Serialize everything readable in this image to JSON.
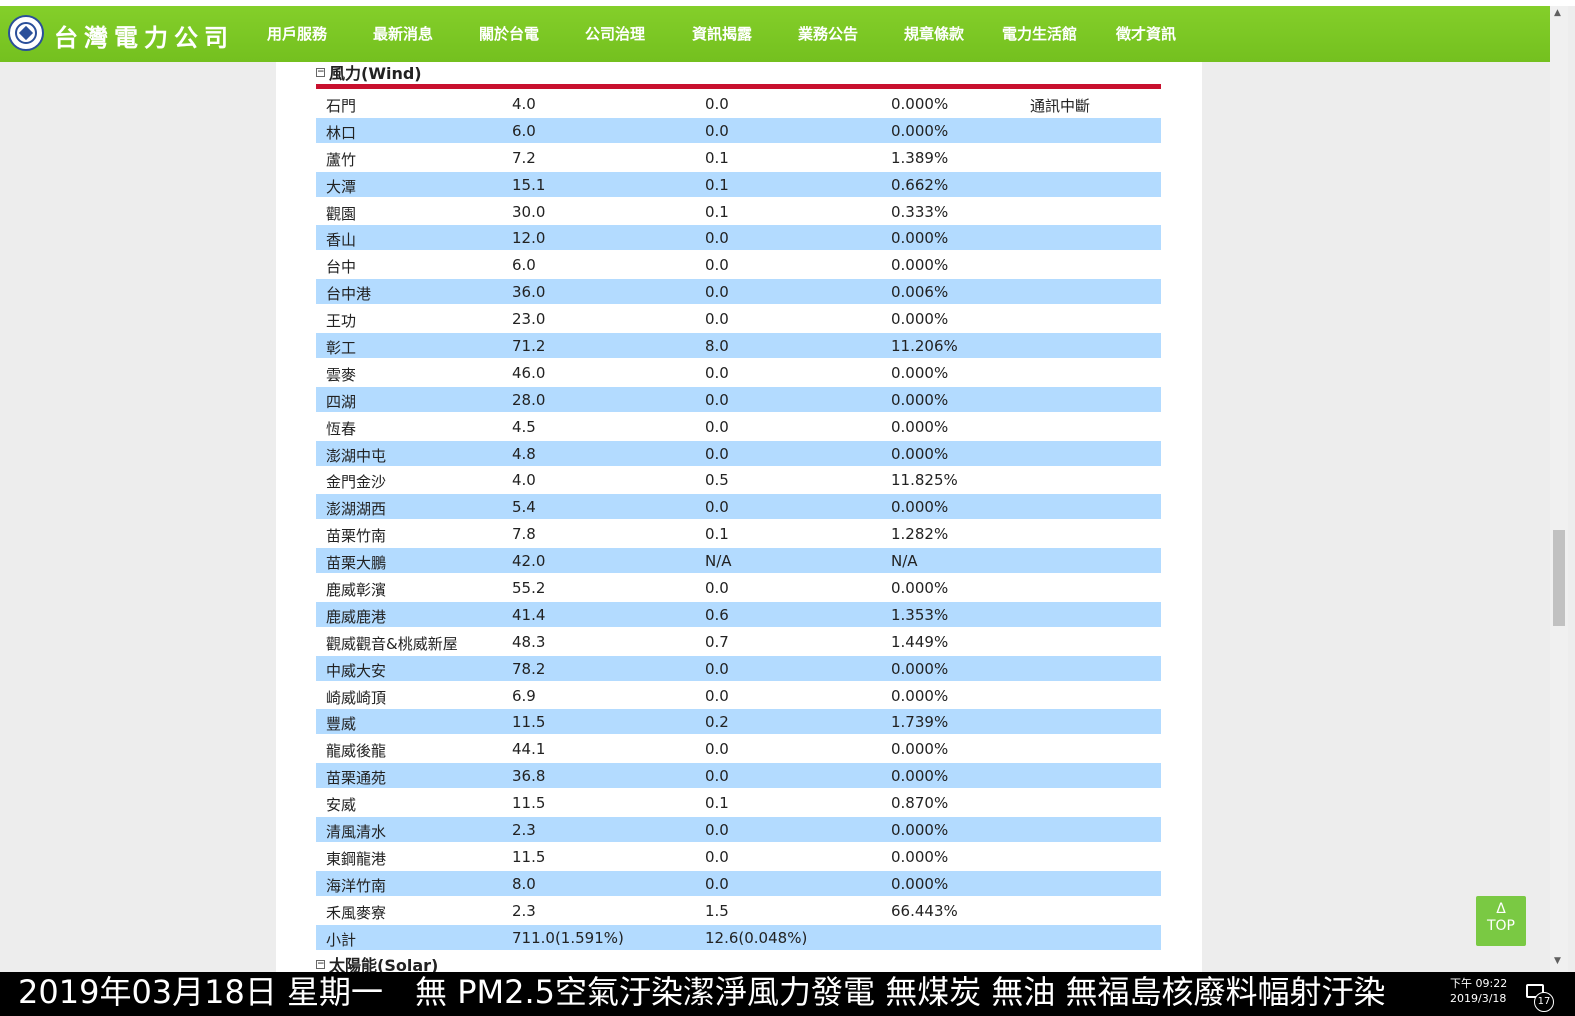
{
  "header": {
    "logo_text": "台灣電力公司",
    "nav": [
      {
        "label": "用戶服務"
      },
      {
        "label": "最新消息"
      },
      {
        "label": "關於台電"
      },
      {
        "label": "公司治理"
      },
      {
        "label": "資訊揭露"
      },
      {
        "label": "業務公告"
      },
      {
        "label": "規章條款"
      },
      {
        "label": "電力生活館"
      },
      {
        "label": "徵才資訊"
      }
    ],
    "active_nav": "資訊揭露"
  },
  "section": {
    "toggle": "⊟",
    "title": "風力(Wind)",
    "rows": [
      {
        "name": "石門",
        "capacity": "4.0",
        "output": "0.0",
        "ratio": "0.000%",
        "note": "通訊中斷"
      },
      {
        "name": "林口",
        "capacity": "6.0",
        "output": "0.0",
        "ratio": "0.000%",
        "note": ""
      },
      {
        "name": "蘆竹",
        "capacity": "7.2",
        "output": "0.1",
        "ratio": "1.389%",
        "note": ""
      },
      {
        "name": "大潭",
        "capacity": "15.1",
        "output": "0.1",
        "ratio": "0.662%",
        "note": ""
      },
      {
        "name": "觀園",
        "capacity": "30.0",
        "output": "0.1",
        "ratio": "0.333%",
        "note": ""
      },
      {
        "name": "香山",
        "capacity": "12.0",
        "output": "0.0",
        "ratio": "0.000%",
        "note": ""
      },
      {
        "name": "台中",
        "capacity": "6.0",
        "output": "0.0",
        "ratio": "0.000%",
        "note": ""
      },
      {
        "name": "台中港",
        "capacity": "36.0",
        "output": "0.0",
        "ratio": "0.006%",
        "note": ""
      },
      {
        "name": "王功",
        "capacity": "23.0",
        "output": "0.0",
        "ratio": "0.000%",
        "note": ""
      },
      {
        "name": "彰工",
        "capacity": "71.2",
        "output": "8.0",
        "ratio": "11.206%",
        "note": ""
      },
      {
        "name": "雲麥",
        "capacity": "46.0",
        "output": "0.0",
        "ratio": "0.000%",
        "note": ""
      },
      {
        "name": "四湖",
        "capacity": "28.0",
        "output": "0.0",
        "ratio": "0.000%",
        "note": ""
      },
      {
        "name": "恆春",
        "capacity": "4.5",
        "output": "0.0",
        "ratio": "0.000%",
        "note": ""
      },
      {
        "name": "澎湖中屯",
        "capacity": "4.8",
        "output": "0.0",
        "ratio": "0.000%",
        "note": ""
      },
      {
        "name": "金門金沙",
        "capacity": "4.0",
        "output": "0.5",
        "ratio": "11.825%",
        "note": ""
      },
      {
        "name": "澎湖湖西",
        "capacity": "5.4",
        "output": "0.0",
        "ratio": "0.000%",
        "note": ""
      },
      {
        "name": "苗栗竹南",
        "capacity": "7.8",
        "output": "0.1",
        "ratio": "1.282%",
        "note": ""
      },
      {
        "name": "苗栗大鵬",
        "capacity": "42.0",
        "output": "N/A",
        "ratio": "N/A",
        "note": ""
      },
      {
        "name": "鹿威彰濱",
        "capacity": "55.2",
        "output": "0.0",
        "ratio": "0.000%",
        "note": ""
      },
      {
        "name": "鹿威鹿港",
        "capacity": "41.4",
        "output": "0.6",
        "ratio": "1.353%",
        "note": ""
      },
      {
        "name": "觀威觀音&桃威新屋",
        "capacity": "48.3",
        "output": "0.7",
        "ratio": "1.449%",
        "note": ""
      },
      {
        "name": "中威大安",
        "capacity": "78.2",
        "output": "0.0",
        "ratio": "0.000%",
        "note": ""
      },
      {
        "name": "崎威崎頂",
        "capacity": "6.9",
        "output": "0.0",
        "ratio": "0.000%",
        "note": ""
      },
      {
        "name": "豐威",
        "capacity": "11.5",
        "output": "0.2",
        "ratio": "1.739%",
        "note": ""
      },
      {
        "name": "龍威後龍",
        "capacity": "44.1",
        "output": "0.0",
        "ratio": "0.000%",
        "note": ""
      },
      {
        "name": "苗栗通苑",
        "capacity": "36.8",
        "output": "0.0",
        "ratio": "0.000%",
        "note": ""
      },
      {
        "name": "安威",
        "capacity": "11.5",
        "output": "0.1",
        "ratio": "0.870%",
        "note": ""
      },
      {
        "name": "清風清水",
        "capacity": "2.3",
        "output": "0.0",
        "ratio": "0.000%",
        "note": ""
      },
      {
        "name": "東鋼龍港",
        "capacity": "11.5",
        "output": "0.0",
        "ratio": "0.000%",
        "note": ""
      },
      {
        "name": "海洋竹南",
        "capacity": "8.0",
        "output": "0.0",
        "ratio": "0.000%",
        "note": ""
      },
      {
        "name": "禾風麥寮",
        "capacity": "2.3",
        "output": "1.5",
        "ratio": "66.443%",
        "note": ""
      },
      {
        "name": "小計",
        "capacity": "711.0(1.591%)",
        "output": "12.6(0.048%)",
        "ratio": "",
        "note": ""
      }
    ]
  },
  "next_section": {
    "toggle": "⊟",
    "title": "太陽能(Solar)"
  },
  "top_button": {
    "arrow": "Δ",
    "label": "TOP"
  },
  "taskbar": {
    "marquee": "2019年03月18日 星期一　無 PM2.5空氣汙染潔淨風力發電 無煤炭 無油 無福島核廢料幅射汙染",
    "time": "下午 09:22",
    "date": "2019/3/18",
    "notifications": "17"
  },
  "colors": {
    "nav_bg": "#7ac625",
    "row_alt": "#b3dbff",
    "section_rule": "#c8102e",
    "top_button": "#7ac943"
  }
}
